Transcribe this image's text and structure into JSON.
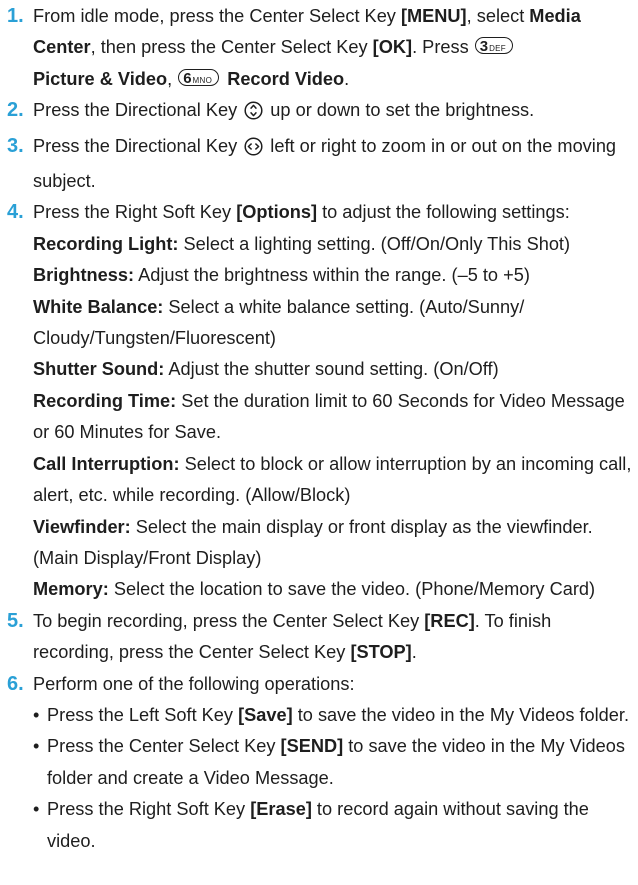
{
  "steps": [
    {
      "num": "1.",
      "t1": "From idle mode, press the Center Select Key ",
      "b1": "[MENU]",
      "t2": ", select ",
      "b2": "Media Center",
      "t3": ", then press the Center Select Key ",
      "b3": "[OK]",
      "t4": ". Press ",
      "key1_digit": "3",
      "key1_letters": "DEF",
      "b4": "Picture & Video",
      "t5": ", ",
      "key2_digit": "6",
      "key2_letters": "MNO",
      "b5": "Record Video",
      "t6": "."
    },
    {
      "num": "2.",
      "t1": "Press the Directional Key ",
      "t2": " up or down to set the brightness.",
      "icon": "updown-key-icon"
    },
    {
      "num": "3.",
      "t1": "Press the Directional Key ",
      "t2": " left or right to zoom in or out on the moving subject.",
      "icon": "leftright-key-icon"
    },
    {
      "num": "4.",
      "t1": "Press the Right Soft Key ",
      "b1": "[Options]",
      "t2": " to adjust the following settings:",
      "settings": [
        {
          "name": "Recording Light:",
          "desc": " Select a lighting setting. (Off/On/Only This Shot)"
        },
        {
          "name": "Brightness:",
          "desc": " Adjust the brightness within the range. (–5 to +5)"
        },
        {
          "name": "White Balance:",
          "desc": " Select a white balance setting. (Auto/Sunny/ Cloudy/Tungsten/Fluorescent)"
        },
        {
          "name": "Shutter Sound:",
          "desc": " Adjust the shutter sound setting. (On/Off)"
        },
        {
          "name": "Recording Time:",
          "desc": " Set the duration limit to 60 Seconds for Video Message or 60 Minutes for Save."
        },
        {
          "name": "Call Interruption:",
          "desc": " Select to block or allow interruption by an incoming call, alert, etc. while recording. (Allow/Block)"
        },
        {
          "name": "Viewfinder:",
          "desc": " Select the main display or front display as the viewfinder. (Main Display/Front Display)"
        },
        {
          "name": "Memory:",
          "desc": " Select the location to save the video. (Phone/Memory Card)"
        }
      ]
    },
    {
      "num": "5.",
      "t1": "To begin recording, press the Center Select Key ",
      "b1": "[REC]",
      "t2": ". To finish recording, press the Center Select Key ",
      "b2": "[STOP]",
      "t3": "."
    },
    {
      "num": "6.",
      "t1": "Perform one of the following operations:",
      "bullets": [
        {
          "t1": "Press the Left Soft Key ",
          "b1": "[Save]",
          "t2": " to save the video in the My Videos folder."
        },
        {
          "t1": "Press the Center Select Key ",
          "b1": "[SEND]",
          "t2": " to save the video in the My Videos folder and create a Video Message."
        },
        {
          "t1": "Press the Right Soft Key ",
          "b1": "[Erase]",
          "t2": " to record again without saving the video."
        }
      ]
    }
  ],
  "colors": {
    "step_number": "#2aa0d6",
    "text": "#1e1e1e"
  }
}
